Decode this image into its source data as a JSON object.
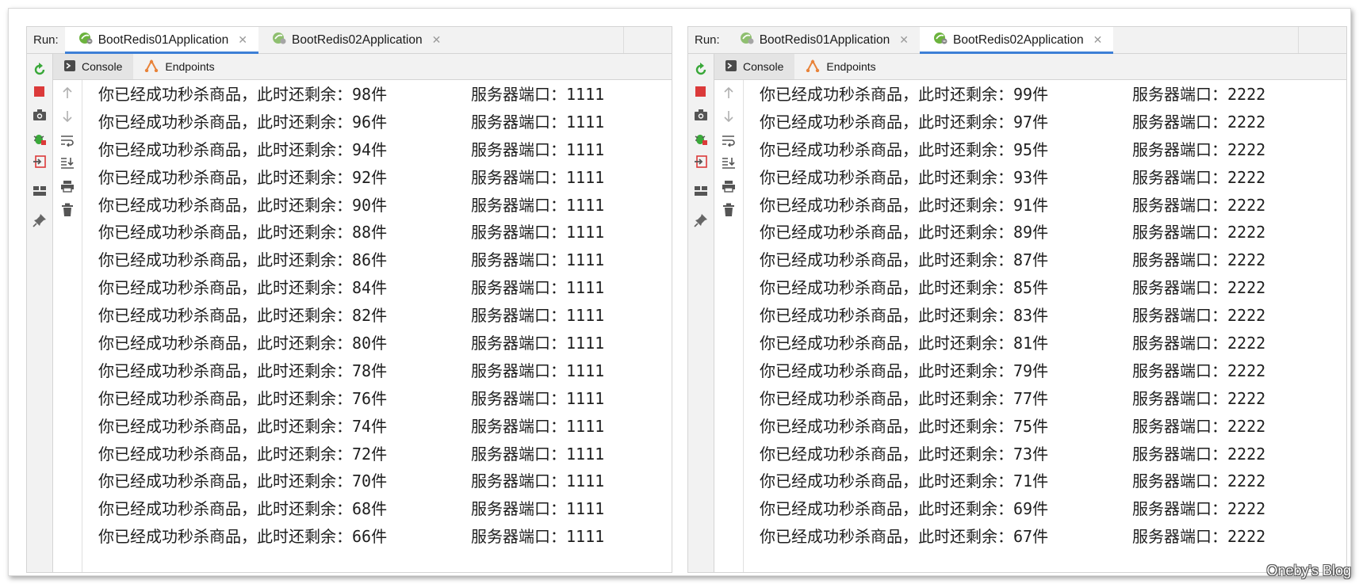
{
  "left_panel": {
    "run_label": "Run:",
    "tabs": [
      {
        "label": "BootRedis01Application",
        "active": true
      },
      {
        "label": "BootRedis02Application",
        "active": false
      }
    ],
    "subtabs": [
      {
        "label": "Console",
        "active": true
      },
      {
        "label": "Endpoints",
        "active": false
      }
    ],
    "lines": [
      {
        "msg": "你已经成功秒杀商品，此时还剩余：98件",
        "port": "服务器端口：1111"
      },
      {
        "msg": "你已经成功秒杀商品，此时还剩余：96件",
        "port": "服务器端口：1111"
      },
      {
        "msg": "你已经成功秒杀商品，此时还剩余：94件",
        "port": "服务器端口：1111"
      },
      {
        "msg": "你已经成功秒杀商品，此时还剩余：92件",
        "port": "服务器端口：1111"
      },
      {
        "msg": "你已经成功秒杀商品，此时还剩余：90件",
        "port": "服务器端口：1111"
      },
      {
        "msg": "你已经成功秒杀商品，此时还剩余：88件",
        "port": "服务器端口：1111"
      },
      {
        "msg": "你已经成功秒杀商品，此时还剩余：86件",
        "port": "服务器端口：1111"
      },
      {
        "msg": "你已经成功秒杀商品，此时还剩余：84件",
        "port": "服务器端口：1111"
      },
      {
        "msg": "你已经成功秒杀商品，此时还剩余：82件",
        "port": "服务器端口：1111"
      },
      {
        "msg": "你已经成功秒杀商品，此时还剩余：80件",
        "port": "服务器端口：1111"
      },
      {
        "msg": "你已经成功秒杀商品，此时还剩余：78件",
        "port": "服务器端口：1111"
      },
      {
        "msg": "你已经成功秒杀商品，此时还剩余：76件",
        "port": "服务器端口：1111"
      },
      {
        "msg": "你已经成功秒杀商品，此时还剩余：74件",
        "port": "服务器端口：1111"
      },
      {
        "msg": "你已经成功秒杀商品，此时还剩余：72件",
        "port": "服务器端口：1111"
      },
      {
        "msg": "你已经成功秒杀商品，此时还剩余：70件",
        "port": "服务器端口：1111"
      },
      {
        "msg": "你已经成功秒杀商品，此时还剩余：68件",
        "port": "服务器端口：1111"
      },
      {
        "msg": "你已经成功秒杀商品，此时还剩余：66件",
        "port": "服务器端口：1111"
      }
    ]
  },
  "right_panel": {
    "run_label": "Run:",
    "tabs": [
      {
        "label": "BootRedis01Application",
        "active": false
      },
      {
        "label": "BootRedis02Application",
        "active": true
      }
    ],
    "subtabs": [
      {
        "label": "Console",
        "active": true
      },
      {
        "label": "Endpoints",
        "active": false
      }
    ],
    "lines": [
      {
        "msg": "你已经成功秒杀商品，此时还剩余：99件",
        "port": "服务器端口：2222"
      },
      {
        "msg": "你已经成功秒杀商品，此时还剩余：97件",
        "port": "服务器端口：2222"
      },
      {
        "msg": "你已经成功秒杀商品，此时还剩余：95件",
        "port": "服务器端口：2222"
      },
      {
        "msg": "你已经成功秒杀商品，此时还剩余：93件",
        "port": "服务器端口：2222"
      },
      {
        "msg": "你已经成功秒杀商品，此时还剩余：91件",
        "port": "服务器端口：2222"
      },
      {
        "msg": "你已经成功秒杀商品，此时还剩余：89件",
        "port": "服务器端口：2222"
      },
      {
        "msg": "你已经成功秒杀商品，此时还剩余：87件",
        "port": "服务器端口：2222"
      },
      {
        "msg": "你已经成功秒杀商品，此时还剩余：85件",
        "port": "服务器端口：2222"
      },
      {
        "msg": "你已经成功秒杀商品，此时还剩余：83件",
        "port": "服务器端口：2222"
      },
      {
        "msg": "你已经成功秒杀商品，此时还剩余：81件",
        "port": "服务器端口：2222"
      },
      {
        "msg": "你已经成功秒杀商品，此时还剩余：79件",
        "port": "服务器端口：2222"
      },
      {
        "msg": "你已经成功秒杀商品，此时还剩余：77件",
        "port": "服务器端口：2222"
      },
      {
        "msg": "你已经成功秒杀商品，此时还剩余：75件",
        "port": "服务器端口：2222"
      },
      {
        "msg": "你已经成功秒杀商品，此时还剩余：73件",
        "port": "服务器端口：2222"
      },
      {
        "msg": "你已经成功秒杀商品，此时还剩余：71件",
        "port": "服务器端口：2222"
      },
      {
        "msg": "你已经成功秒杀商品，此时还剩余：69件",
        "port": "服务器端口：2222"
      },
      {
        "msg": "你已经成功秒杀商品，此时还剩余：67件",
        "port": "服务器端口：2222"
      }
    ]
  },
  "icons": {
    "left_toolbar": [
      "rerun-icon",
      "stop-icon",
      "camera-icon",
      "debug-icon",
      "exit-icon",
      "layout-icon",
      "pin-icon"
    ],
    "tool_column": [
      "scroll-up-icon",
      "scroll-down-icon",
      "soft-wrap-icon",
      "scroll-to-end-icon",
      "print-icon",
      "trash-icon"
    ]
  },
  "colors": {
    "accent": "#3d7fd6",
    "rerun": "#3aa83a",
    "stop": "#db3a3a",
    "spring": "#6cb33e"
  },
  "watermark": "Oneby's Blog"
}
